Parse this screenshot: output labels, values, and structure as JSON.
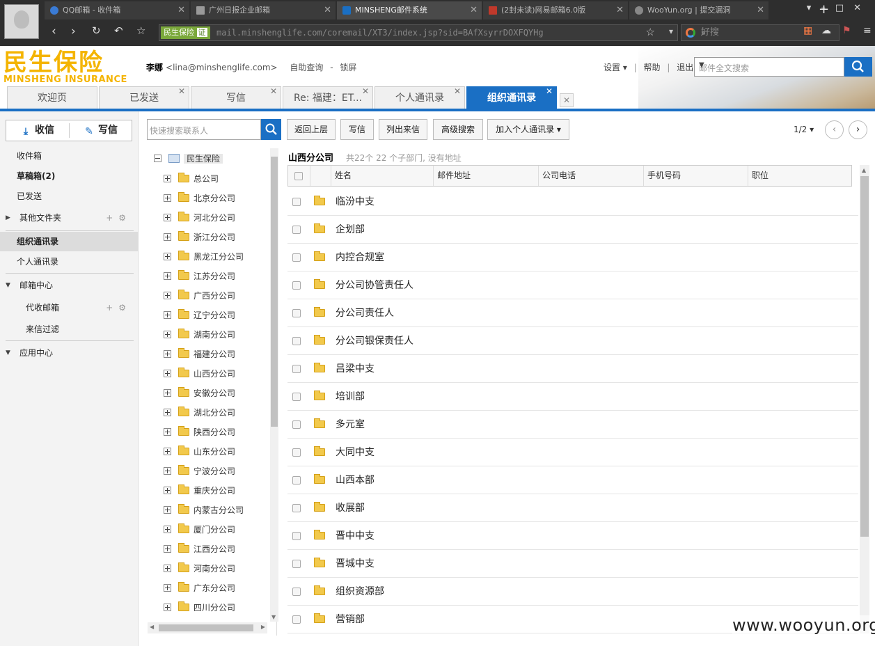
{
  "browser": {
    "tabs": [
      {
        "label": "QQ邮箱 - 收件箱",
        "fav": "#3a7bd5"
      },
      {
        "label": "广州日报企业邮箱",
        "fav": "#999999"
      },
      {
        "label": "MINSHENG邮件系统",
        "fav": "#1a6fc4"
      },
      {
        "label": "(2封未读)网易邮箱6.0版",
        "fav": "#c0392b"
      },
      {
        "label": "WooYun.org | 提交漏洞",
        "fav": "#888888"
      }
    ],
    "new_tab": "+",
    "secure_label": "民生保险",
    "cert_label": "证",
    "url": "mail.minshenglife.com/coremail/XT3/index.jsp?sid=BAfXsyrrDOXFQYHg",
    "search_text": "好搜"
  },
  "header": {
    "logo_cn": "民生保险",
    "logo_en": "MINSHENG INSURANCE",
    "user_name": "李娜",
    "user_email": "<lina@minshenglife.com>",
    "self_query": "自助查询",
    "separator": "-",
    "lock_screen": "锁屏",
    "settings": "设置 ▾",
    "help": "帮助",
    "logout": "退出",
    "pipe": "|",
    "search_placeholder": "邮件全文搜索"
  },
  "mail_tabs": [
    {
      "label": "欢迎页"
    },
    {
      "label": "已发送"
    },
    {
      "label": "写信"
    },
    {
      "label": "Re: 福建：ET..."
    },
    {
      "label": "个人通讯录"
    },
    {
      "label": "组织通讯录"
    }
  ],
  "sidebar": {
    "receive": "收信",
    "compose": "写信",
    "items": {
      "inbox": "收件箱",
      "drafts": "草稿箱(2)",
      "sent": "已发送",
      "other": "其他文件夹",
      "org_contacts": "组织通讯录",
      "personal_contacts": "个人通讯录",
      "mailbox_center": "邮箱中心",
      "proxy_mail": "代收邮箱",
      "filter": "来信过滤",
      "app_center": "应用中心"
    }
  },
  "contacts": {
    "search_placeholder": "快速搜索联系人",
    "tree_root": "民生保险",
    "tree_nodes": [
      "总公司",
      "北京分公司",
      "河北分公司",
      "浙江分公司",
      "黑龙江分公司",
      "江苏分公司",
      "广西分公司",
      "辽宁分公司",
      "湖南分公司",
      "福建分公司",
      "山西分公司",
      "安徽分公司",
      "湖北分公司",
      "陕西分公司",
      "山东分公司",
      "宁波分公司",
      "重庆分公司",
      "内蒙古分公司",
      "厦门分公司",
      "江西分公司",
      "河南分公司",
      "广东分公司",
      "四川分公司"
    ],
    "toolbar": {
      "back": "返回上层",
      "write": "写信",
      "list_mail": "列出来信",
      "advanced": "高级搜索",
      "add_personal": "加入个人通讯录 ▾"
    },
    "pager": "1/2 ▾",
    "dept_title": "山西分公司",
    "dept_info": "共22个 22 个子部门, 没有地址",
    "columns": [
      "姓名",
      "邮件地址",
      "公司电话",
      "手机号码",
      "职位"
    ],
    "rows": [
      "临汾中支",
      "企划部",
      "内控合规室",
      "分公司协管责任人",
      "分公司责任人",
      "分公司银保责任人",
      "吕梁中支",
      "培训部",
      "多元室",
      "大同中支",
      "山西本部",
      "收展部",
      "晋中中支",
      "晋城中支",
      "组织资源部",
      "营销部"
    ]
  },
  "watermark": "www.wooyun.org"
}
